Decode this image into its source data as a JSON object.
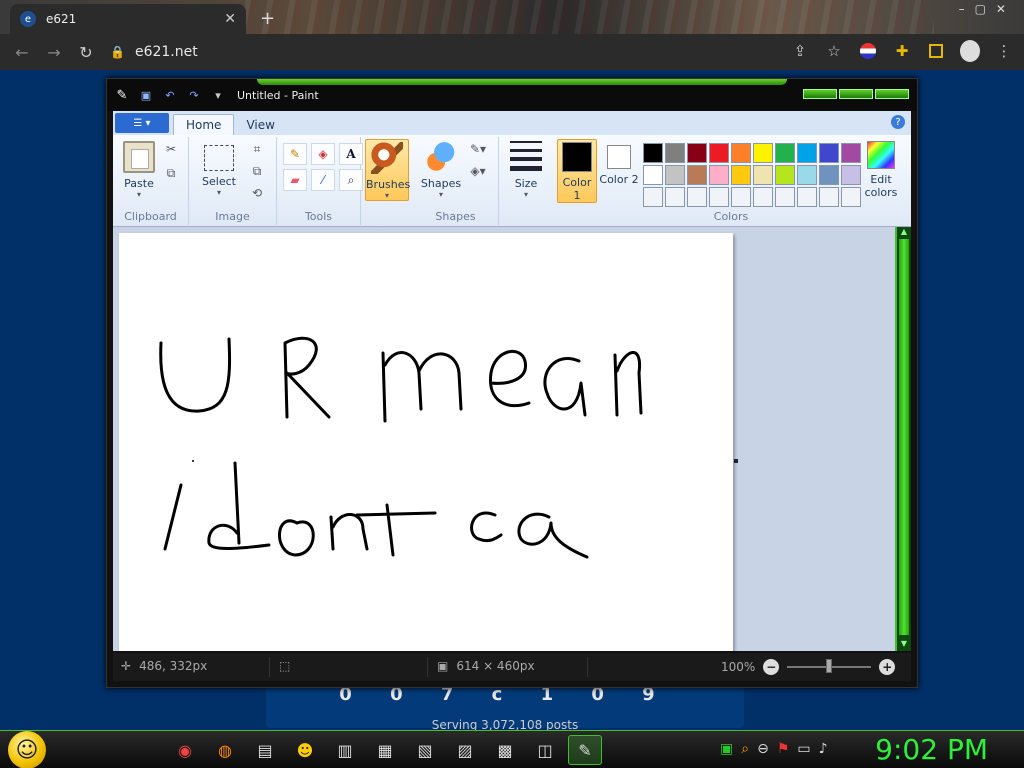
{
  "browser": {
    "tab_title": "e621",
    "favicon_text": "e",
    "tab_close": "✕",
    "new_tab": "+",
    "window_controls": "–▢✕",
    "url": "e621.net"
  },
  "page_behind": {
    "counter": "0 0 7 c 1 0 9",
    "serving": "Serving 3,072,108 posts"
  },
  "paint": {
    "window_title": "Untitled - Paint",
    "tabs": [
      "Home",
      "View"
    ],
    "help": "?",
    "groups": {
      "clipboard": {
        "label": "Clipboard",
        "paste": "Paste"
      },
      "image": {
        "label": "Image",
        "select": "Select"
      },
      "tools": {
        "label": "Tools"
      },
      "brushes": {
        "label": "Brushes"
      },
      "shapes": {
        "label": "Shapes",
        "button": "Shapes"
      },
      "size": {
        "label": "Size"
      },
      "colors": {
        "label": "Colors",
        "color1": "Color 1",
        "color2": "Color 2",
        "edit": "Edit colors",
        "color1_value": "#000000",
        "color2_value": "#ffffff",
        "palette": [
          "#000000",
          "#7f7f7f",
          "#880015",
          "#ed1c24",
          "#ff7f27",
          "#fff200",
          "#22b14c",
          "#00a2e8",
          "#3f48cc",
          "#a349a4",
          "#ffffff",
          "#c3c3c3",
          "#b97a57",
          "#ffaec9",
          "#ffc90e",
          "#efe4b0",
          "#b5e61d",
          "#99d9ea",
          "#7092be",
          "#c8bfe7",
          "#f0f4f8",
          "#f0f4f8",
          "#f0f4f8",
          "#f0f4f8",
          "#f0f4f8",
          "#f0f4f8",
          "#f0f4f8",
          "#f0f4f8",
          "#f0f4f8",
          "#f0f4f8"
        ]
      }
    },
    "status": {
      "cursor_pos": "486, 332px",
      "canvas_size": "614 × 460px",
      "zoom": "100%",
      "zoom_out": "−",
      "zoom_in": "+"
    }
  },
  "taskbar": {
    "clock": "9:02 PM"
  }
}
